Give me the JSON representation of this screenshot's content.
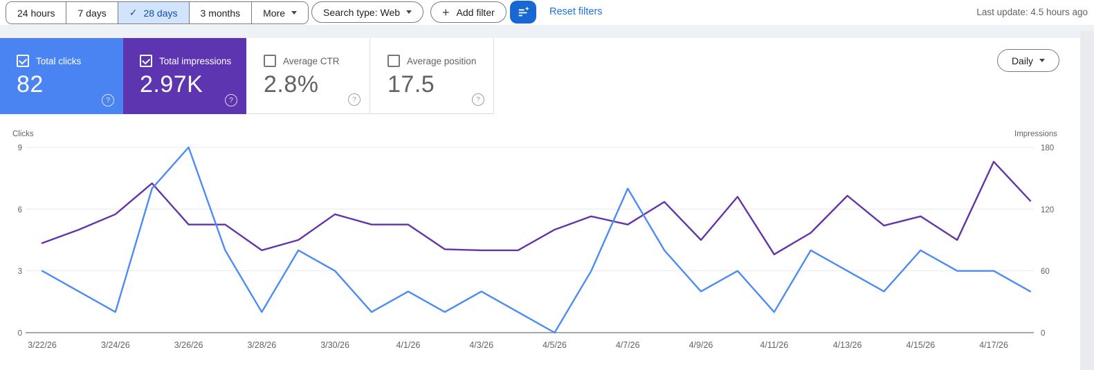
{
  "toolbar": {
    "date_ranges": [
      {
        "label": "24 hours",
        "selected": false,
        "has_dropdown": false
      },
      {
        "label": "7 days",
        "selected": false,
        "has_dropdown": false
      },
      {
        "label": "28 days",
        "selected": true,
        "has_dropdown": false
      },
      {
        "label": "3 months",
        "selected": false,
        "has_dropdown": false
      },
      {
        "label": "More",
        "selected": false,
        "has_dropdown": true
      }
    ],
    "search_type_label": "Search type: Web",
    "add_filter_label": "Add filter",
    "reset_filters_label": "Reset filters",
    "last_update": "Last update: 4.5 hours ago",
    "filter_button_color": "#1967d2"
  },
  "icons": {
    "check": "✓",
    "plus": "+",
    "help": "?"
  },
  "metric_cards": [
    {
      "label": "Total clicks",
      "value": "82",
      "checked": true,
      "bg": "#4a84f3",
      "text": "#ffffff"
    },
    {
      "label": "Total impressions",
      "value": "2.97K",
      "checked": true,
      "bg": "#5e35b1",
      "text": "#ffffff"
    },
    {
      "label": "Average CTR",
      "value": "2.8%",
      "checked": false,
      "bg": "#ffffff",
      "text": "#5f6368"
    },
    {
      "label": "Average position",
      "value": "17.5",
      "checked": false,
      "bg": "#ffffff",
      "text": "#5f6368"
    }
  ],
  "granularity": {
    "label": "Daily"
  },
  "chart_data": {
    "type": "line",
    "x": [
      "3/22/26",
      "3/23/26",
      "3/24/26",
      "3/25/26",
      "3/26/26",
      "3/27/26",
      "3/28/26",
      "3/29/26",
      "3/30/26",
      "3/31/26",
      "4/1/26",
      "4/2/26",
      "4/3/26",
      "4/4/26",
      "4/5/26",
      "4/6/26",
      "4/7/26",
      "4/8/26",
      "4/9/26",
      "4/10/26",
      "4/11/26",
      "4/12/26",
      "4/13/26",
      "4/14/26",
      "4/15/26",
      "4/16/26",
      "4/17/26",
      "4/18/26"
    ],
    "x_tick_every": 2,
    "series": [
      {
        "name": "Clicks",
        "axis": "left",
        "color": "#4c8bf5",
        "values": [
          3,
          2,
          1,
          7,
          9,
          4,
          1,
          4,
          3,
          1,
          2,
          1,
          2,
          1,
          0,
          3,
          7,
          4,
          2,
          3,
          1,
          4,
          3,
          2,
          4,
          3,
          3,
          2
        ]
      },
      {
        "name": "Impressions",
        "axis": "right",
        "color": "#6333a8",
        "values": [
          87,
          100,
          115,
          145,
          105,
          105,
          80,
          90,
          115,
          105,
          105,
          81,
          80,
          80,
          100,
          113,
          105,
          127,
          90,
          132,
          76,
          97,
          133,
          104,
          113,
          90,
          166,
          128
        ]
      }
    ],
    "left_axis": {
      "label": "Clicks",
      "ticks": [
        0,
        3,
        6,
        9
      ],
      "max": 9
    },
    "right_axis": {
      "label": "Impressions",
      "ticks": [
        0,
        60,
        120,
        180
      ],
      "max": 180
    },
    "grid": true,
    "legend_position": "none"
  }
}
